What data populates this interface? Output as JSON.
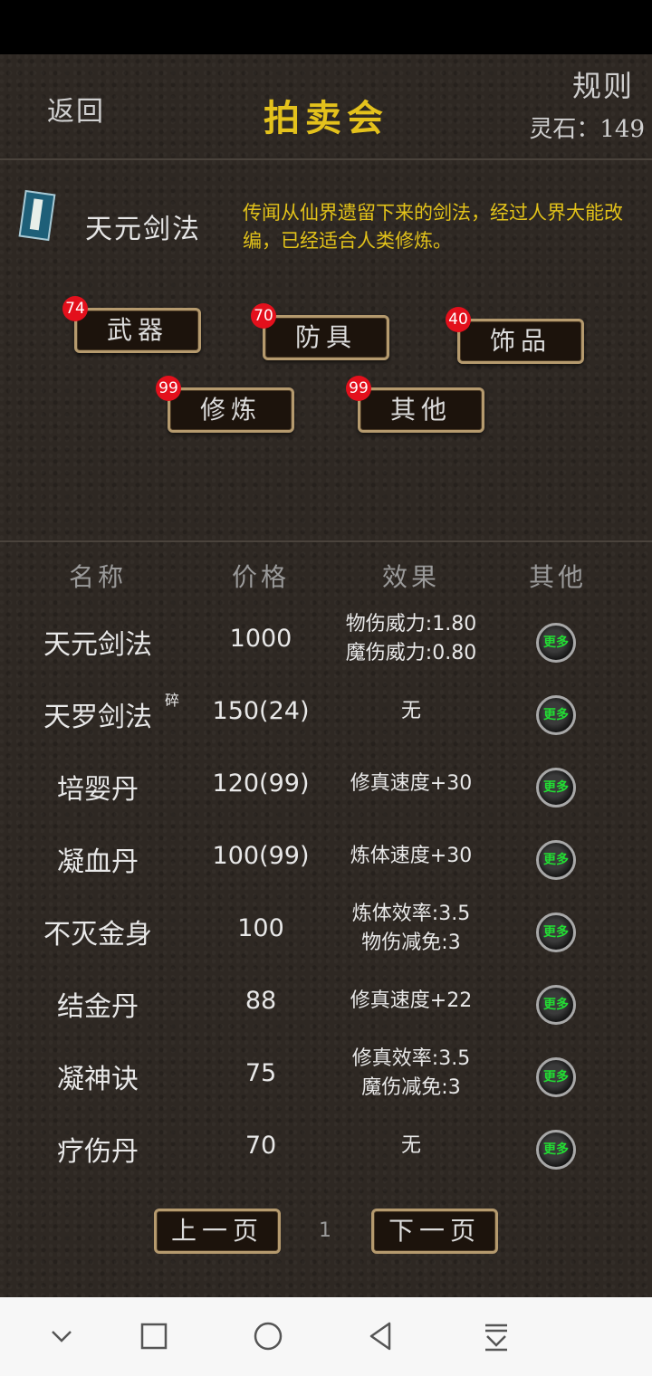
{
  "header": {
    "back_label": "返回",
    "title": "拍卖会",
    "rules_label": "规则",
    "stone_text": "灵石：149"
  },
  "featured": {
    "name": "天元剑法",
    "description": "传闻从仙界遗留下来的剑法，经过人界大能改编，已经适合人类修炼。",
    "icon": "book-icon"
  },
  "categories": [
    {
      "label": "武器",
      "count": "74"
    },
    {
      "label": "防具",
      "count": "70"
    },
    {
      "label": "饰品",
      "count": "40"
    },
    {
      "label": "修炼",
      "count": "99"
    },
    {
      "label": "其他",
      "count": "99"
    }
  ],
  "table": {
    "headers": [
      "名称",
      "价格",
      "效果",
      "其他"
    ],
    "rows": [
      {
        "name": "天元剑法",
        "price": "1000",
        "effect1": "物伤威力:1.80",
        "effect2": "魔伤威力:0.80",
        "more": "更多"
      },
      {
        "name": "天罗剑法",
        "tag": "碎",
        "price": "150(24)",
        "effect1": "无",
        "effect2": "",
        "more": "更多"
      },
      {
        "name": "培婴丹",
        "price": "120(99)",
        "effect1": "修真速度+30",
        "effect2": "",
        "more": "更多"
      },
      {
        "name": "凝血丹",
        "price": "100(99)",
        "effect1": "炼体速度+30",
        "effect2": "",
        "more": "更多"
      },
      {
        "name": "不灭金身",
        "price": "100",
        "effect1": "炼体效率:3.5",
        "effect2": "物伤减免:3",
        "more": "更多"
      },
      {
        "name": "结金丹",
        "price": "88",
        "effect1": "修真速度+22",
        "effect2": "",
        "more": "更多"
      },
      {
        "name": "凝神诀",
        "price": "75",
        "effect1": "修真效率:3.5",
        "effect2": "魔伤减免:3",
        "more": "更多"
      },
      {
        "name": "疗伤丹",
        "price": "70",
        "effect1": "无",
        "effect2": "",
        "more": "更多"
      }
    ]
  },
  "pagination": {
    "prev_label": "上一页",
    "page": "1",
    "next_label": "下一页"
  },
  "colors": {
    "title": "#e4c21c",
    "badge": "#e3101c",
    "more_text": "#22dd33"
  },
  "navbar": {
    "icons": [
      "chevron-down-icon",
      "square-icon",
      "circle-icon",
      "triangle-back-icon",
      "download-icon"
    ]
  }
}
